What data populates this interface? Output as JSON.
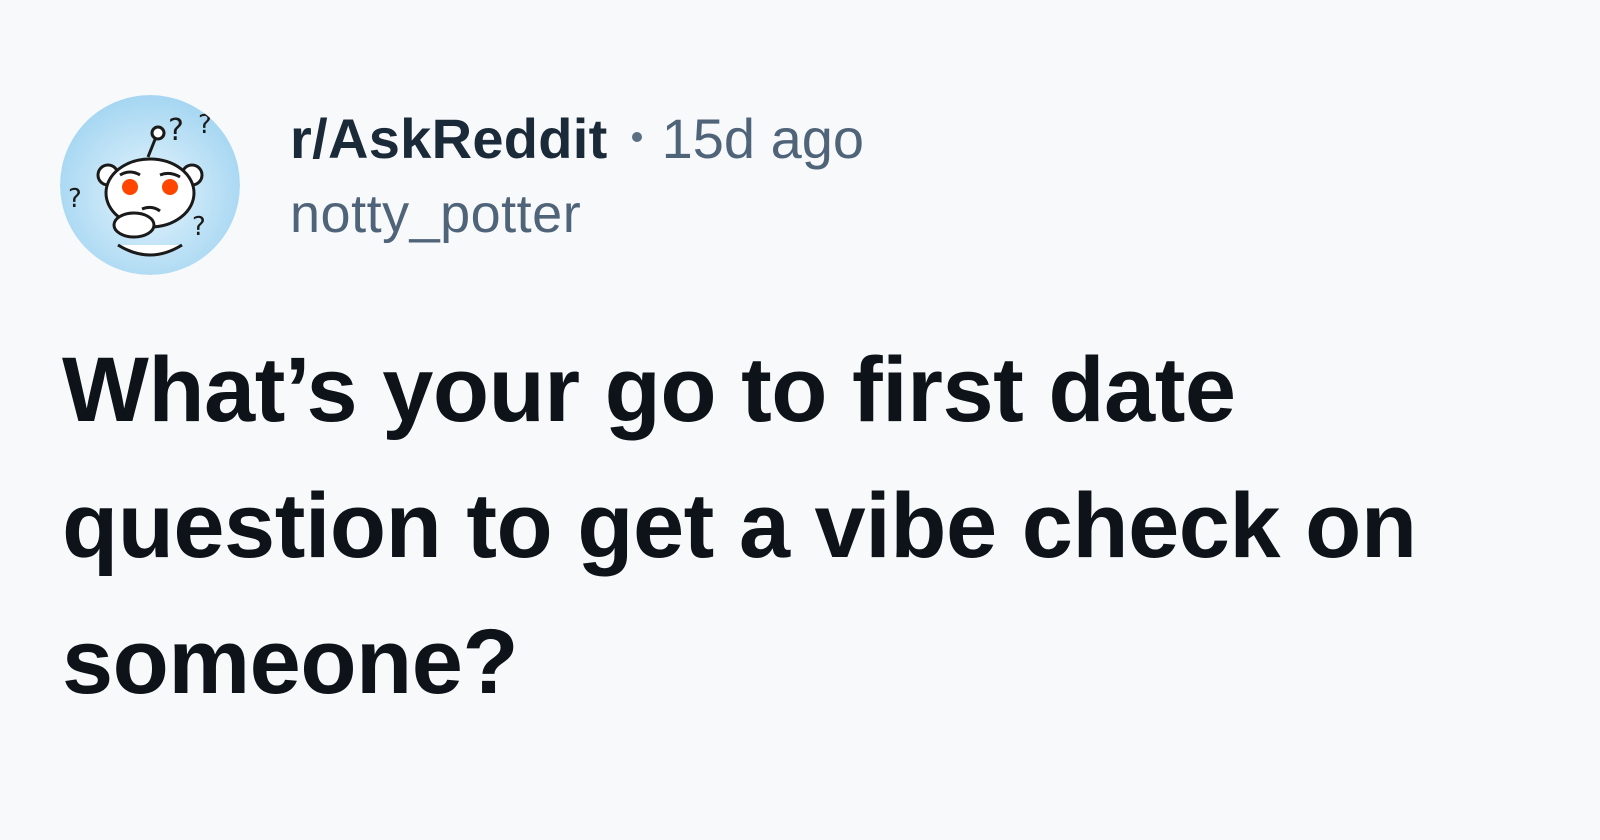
{
  "post": {
    "avatar_icon": "reddit-snoo-confused-icon",
    "subreddit": "r/AskReddit",
    "age": "15d ago",
    "author": "notty_potter",
    "title": "What’s your go to first date question to get a vibe check on someone?"
  },
  "colors": {
    "background": "#f7f9fb",
    "title": "#0d1318",
    "meta": "#4f6479",
    "avatar_bg": "#bfe3f7",
    "snoo_eyes": "#ff4500"
  }
}
